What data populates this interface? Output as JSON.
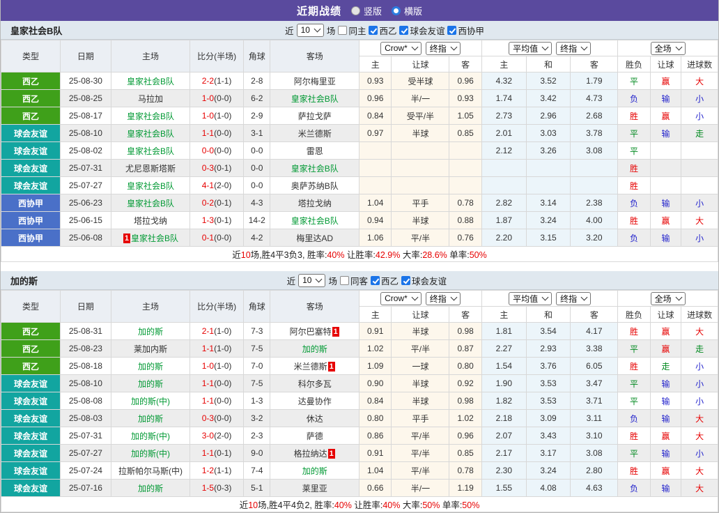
{
  "title_bar": {
    "title": "近期战绩",
    "radios": [
      {
        "label": "竖版",
        "selected": false
      },
      {
        "label": "横版",
        "selected": true
      }
    ]
  },
  "colors": {
    "topbar": "#5a4a9e",
    "league_green": "#3fa01a",
    "league_teal": "#12a5a0",
    "league_blue": "#4a70c8",
    "team_highlight": "#009933",
    "win_red": "#e60000",
    "loss_blue": "#2323cc",
    "draw_green": "#00891f",
    "crow_bg": "#fdf7ec",
    "avg_bg": "#ecf5fa"
  },
  "col_headers": {
    "type": "类型",
    "date": "日期",
    "home": "主场",
    "score": "比分(半场)",
    "corner": "角球",
    "away": "客场",
    "crow_select": "Crow*",
    "final_select": "终指",
    "avg_select": "平均值",
    "full_select": "全场",
    "odds_home": "主",
    "odds_handicap": "让球",
    "odds_away": "客",
    "avg_home": "主",
    "avg_draw": "和",
    "avg_away": "客",
    "result": "胜负",
    "handicap_result": "让球",
    "goals": "进球数"
  },
  "sections": [
    {
      "team": "皇家社会B队",
      "filters": {
        "recent_label": "近",
        "recent_value": "10",
        "matches_label": "场",
        "checkboxes": [
          {
            "label": "同主",
            "checked": false
          },
          {
            "label": "西乙",
            "checked": true
          },
          {
            "label": "球会友谊",
            "checked": true
          },
          {
            "label": "西协甲",
            "checked": true
          }
        ]
      },
      "rows": [
        {
          "league": "西乙",
          "lc": "green",
          "date": "25-08-30",
          "home": {
            "name": "皇家社会B队",
            "hl": true
          },
          "ft": "2-2",
          "ht": "(1-1)",
          "corner": "2-8",
          "away": {
            "name": "阿尔梅里亚",
            "hl": false
          },
          "odds": [
            "0.93",
            "受半球",
            "0.96"
          ],
          "avg": [
            "4.32",
            "3.52",
            "1.79"
          ],
          "res": [
            {
              "t": "平",
              "c": "green"
            },
            {
              "t": "赢",
              "c": "red"
            },
            {
              "t": "大",
              "c": "red"
            }
          ]
        },
        {
          "league": "西乙",
          "lc": "green",
          "date": "25-08-25",
          "home": {
            "name": "马拉加",
            "hl": false
          },
          "ft": "1-0",
          "ht": "(0-0)",
          "corner": "6-2",
          "away": {
            "name": "皇家社会B队",
            "hl": true
          },
          "odds": [
            "0.96",
            "半/一",
            "0.93"
          ],
          "avg": [
            "1.74",
            "3.42",
            "4.73"
          ],
          "res": [
            {
              "t": "负",
              "c": "blue"
            },
            {
              "t": "输",
              "c": "blue"
            },
            {
              "t": "小",
              "c": "blue"
            }
          ]
        },
        {
          "league": "西乙",
          "lc": "green",
          "date": "25-08-17",
          "home": {
            "name": "皇家社会B队",
            "hl": true
          },
          "ft": "1-0",
          "ht": "(1-0)",
          "corner": "2-9",
          "away": {
            "name": "萨拉戈萨",
            "hl": false
          },
          "odds": [
            "0.84",
            "受平/半",
            "1.05"
          ],
          "avg": [
            "2.73",
            "2.96",
            "2.68"
          ],
          "res": [
            {
              "t": "胜",
              "c": "red"
            },
            {
              "t": "赢",
              "c": "red"
            },
            {
              "t": "小",
              "c": "blue"
            }
          ]
        },
        {
          "league": "球会友谊",
          "lc": "teal",
          "date": "25-08-10",
          "home": {
            "name": "皇家社会B队",
            "hl": true
          },
          "ft": "1-1",
          "ht": "(0-0)",
          "corner": "3-1",
          "away": {
            "name": "米兰德斯",
            "hl": false
          },
          "odds": [
            "0.97",
            "半球",
            "0.85"
          ],
          "avg": [
            "2.01",
            "3.03",
            "3.78"
          ],
          "res": [
            {
              "t": "平",
              "c": "green"
            },
            {
              "t": "输",
              "c": "blue"
            },
            {
              "t": "走",
              "c": "green"
            }
          ]
        },
        {
          "league": "球会友谊",
          "lc": "teal",
          "date": "25-08-02",
          "home": {
            "name": "皇家社会B队",
            "hl": true
          },
          "ft": "0-0",
          "ht": "(0-0)",
          "corner": "0-0",
          "away": {
            "name": "雷恩",
            "hl": false
          },
          "odds": [
            "",
            "",
            ""
          ],
          "avg": [
            "2.12",
            "3.26",
            "3.08"
          ],
          "res": [
            {
              "t": "平",
              "c": "green"
            },
            {
              "t": "",
              "c": ""
            },
            {
              "t": "",
              "c": ""
            }
          ]
        },
        {
          "league": "球会友谊",
          "lc": "teal",
          "date": "25-07-31",
          "home": {
            "name": "尤尼恩斯塔斯",
            "hl": false
          },
          "ft": "0-3",
          "ht": "(0-1)",
          "corner": "0-0",
          "away": {
            "name": "皇家社会B队",
            "hl": true
          },
          "odds": [
            "",
            "",
            ""
          ],
          "avg": [
            "",
            "",
            ""
          ],
          "res": [
            {
              "t": "胜",
              "c": "red"
            },
            {
              "t": "",
              "c": ""
            },
            {
              "t": "",
              "c": ""
            }
          ]
        },
        {
          "league": "球会友谊",
          "lc": "teal",
          "date": "25-07-27",
          "home": {
            "name": "皇家社会B队",
            "hl": true
          },
          "ft": "4-1",
          "ht": "(2-0)",
          "corner": "0-0",
          "away": {
            "name": "奥萨苏纳B队",
            "hl": false
          },
          "odds": [
            "",
            "",
            ""
          ],
          "avg": [
            "",
            "",
            ""
          ],
          "res": [
            {
              "t": "胜",
              "c": "red"
            },
            {
              "t": "",
              "c": ""
            },
            {
              "t": "",
              "c": ""
            }
          ]
        },
        {
          "league": "西协甲",
          "lc": "blue",
          "date": "25-06-23",
          "home": {
            "name": "皇家社会B队",
            "hl": true
          },
          "ft": "0-2",
          "ht": "(0-1)",
          "corner": "4-3",
          "away": {
            "name": "塔拉戈纳",
            "hl": false
          },
          "odds": [
            "1.04",
            "平手",
            "0.78"
          ],
          "avg": [
            "2.82",
            "3.14",
            "2.38"
          ],
          "res": [
            {
              "t": "负",
              "c": "blue"
            },
            {
              "t": "输",
              "c": "blue"
            },
            {
              "t": "小",
              "c": "blue"
            }
          ]
        },
        {
          "league": "西协甲",
          "lc": "blue",
          "date": "25-06-15",
          "home": {
            "name": "塔拉戈纳",
            "hl": false
          },
          "ft": "1-3",
          "ht": "(0-1)",
          "corner": "14-2",
          "away": {
            "name": "皇家社会B队",
            "hl": true
          },
          "odds": [
            "0.94",
            "半球",
            "0.88"
          ],
          "avg": [
            "1.87",
            "3.24",
            "4.00"
          ],
          "res": [
            {
              "t": "胜",
              "c": "red"
            },
            {
              "t": "赢",
              "c": "red"
            },
            {
              "t": "大",
              "c": "red"
            }
          ]
        },
        {
          "league": "西协甲",
          "lc": "blue",
          "date": "25-06-08",
          "home": {
            "name": "皇家社会B队",
            "hl": true,
            "badge": "1",
            "badge_pos": "before"
          },
          "ft": "0-1",
          "ht": "(0-0)",
          "corner": "4-2",
          "away": {
            "name": "梅里达AD",
            "hl": false
          },
          "odds": [
            "1.06",
            "平/半",
            "0.76"
          ],
          "avg": [
            "2.20",
            "3.15",
            "3.20"
          ],
          "res": [
            {
              "t": "负",
              "c": "blue"
            },
            {
              "t": "输",
              "c": "blue"
            },
            {
              "t": "小",
              "c": "blue"
            }
          ]
        }
      ],
      "summary": [
        {
          "text": "近",
          "red": false
        },
        {
          "text": "10",
          "red": true
        },
        {
          "text": "场,胜4平3负3, 胜率:",
          "red": false
        },
        {
          "text": "40%",
          "red": true
        },
        {
          "text": " 让胜率:",
          "red": false
        },
        {
          "text": "42.9%",
          "red": true
        },
        {
          "text": " 大率:",
          "red": false
        },
        {
          "text": "28.6%",
          "red": true
        },
        {
          "text": " 单率:",
          "red": false
        },
        {
          "text": "50%",
          "red": true
        }
      ]
    },
    {
      "team": "加的斯",
      "filters": {
        "recent_label": "近",
        "recent_value": "10",
        "matches_label": "场",
        "checkboxes": [
          {
            "label": "同客",
            "checked": false
          },
          {
            "label": "西乙",
            "checked": true
          },
          {
            "label": "球会友谊",
            "checked": true
          }
        ]
      },
      "rows": [
        {
          "league": "西乙",
          "lc": "green",
          "date": "25-08-31",
          "home": {
            "name": "加的斯",
            "hl": true
          },
          "ft": "2-1",
          "ht": "(1-0)",
          "corner": "7-3",
          "away": {
            "name": "阿尔巴塞特",
            "hl": false,
            "badge": "1",
            "badge_pos": "after"
          },
          "odds": [
            "0.91",
            "半球",
            "0.98"
          ],
          "avg": [
            "1.81",
            "3.54",
            "4.17"
          ],
          "res": [
            {
              "t": "胜",
              "c": "red"
            },
            {
              "t": "赢",
              "c": "red"
            },
            {
              "t": "大",
              "c": "red"
            }
          ]
        },
        {
          "league": "西乙",
          "lc": "green",
          "date": "25-08-23",
          "home": {
            "name": "莱加内斯",
            "hl": false
          },
          "ft": "1-1",
          "ht": "(1-0)",
          "corner": "7-5",
          "away": {
            "name": "加的斯",
            "hl": true
          },
          "odds": [
            "1.02",
            "平/半",
            "0.87"
          ],
          "avg": [
            "2.27",
            "2.93",
            "3.38"
          ],
          "res": [
            {
              "t": "平",
              "c": "green"
            },
            {
              "t": "赢",
              "c": "red"
            },
            {
              "t": "走",
              "c": "green"
            }
          ]
        },
        {
          "league": "西乙",
          "lc": "green",
          "date": "25-08-18",
          "home": {
            "name": "加的斯",
            "hl": true
          },
          "ft": "1-0",
          "ht": "(1-0)",
          "corner": "7-0",
          "away": {
            "name": "米兰德斯",
            "hl": false,
            "badge": "1",
            "badge_pos": "after"
          },
          "odds": [
            "1.09",
            "一球",
            "0.80"
          ],
          "avg": [
            "1.54",
            "3.76",
            "6.05"
          ],
          "res": [
            {
              "t": "胜",
              "c": "red"
            },
            {
              "t": "走",
              "c": "green"
            },
            {
              "t": "小",
              "c": "blue"
            }
          ]
        },
        {
          "league": "球会友谊",
          "lc": "teal",
          "date": "25-08-10",
          "home": {
            "name": "加的斯",
            "hl": true
          },
          "ft": "1-1",
          "ht": "(0-0)",
          "corner": "7-5",
          "away": {
            "name": "科尔多瓦",
            "hl": false
          },
          "odds": [
            "0.90",
            "半球",
            "0.92"
          ],
          "avg": [
            "1.90",
            "3.53",
            "3.47"
          ],
          "res": [
            {
              "t": "平",
              "c": "green"
            },
            {
              "t": "输",
              "c": "blue"
            },
            {
              "t": "小",
              "c": "blue"
            }
          ]
        },
        {
          "league": "球会友谊",
          "lc": "teal",
          "date": "25-08-08",
          "home": {
            "name": "加的斯(中)",
            "hl": true
          },
          "ft": "1-1",
          "ht": "(0-0)",
          "corner": "1-3",
          "away": {
            "name": "达曼协作",
            "hl": false
          },
          "odds": [
            "0.84",
            "半球",
            "0.98"
          ],
          "avg": [
            "1.82",
            "3.53",
            "3.71"
          ],
          "res": [
            {
              "t": "平",
              "c": "green"
            },
            {
              "t": "输",
              "c": "blue"
            },
            {
              "t": "小",
              "c": "blue"
            }
          ]
        },
        {
          "league": "球会友谊",
          "lc": "teal",
          "date": "25-08-03",
          "home": {
            "name": "加的斯",
            "hl": true
          },
          "ft": "0-3",
          "ht": "(0-0)",
          "corner": "3-2",
          "away": {
            "name": "休达",
            "hl": false
          },
          "odds": [
            "0.80",
            "平手",
            "1.02"
          ],
          "avg": [
            "2.18",
            "3.09",
            "3.11"
          ],
          "res": [
            {
              "t": "负",
              "c": "blue"
            },
            {
              "t": "输",
              "c": "blue"
            },
            {
              "t": "大",
              "c": "red"
            }
          ]
        },
        {
          "league": "球会友谊",
          "lc": "teal",
          "date": "25-07-31",
          "home": {
            "name": "加的斯(中)",
            "hl": true
          },
          "ft": "3-0",
          "ht": "(2-0)",
          "corner": "2-3",
          "away": {
            "name": "萨德",
            "hl": false
          },
          "odds": [
            "0.86",
            "平/半",
            "0.96"
          ],
          "avg": [
            "2.07",
            "3.43",
            "3.10"
          ],
          "res": [
            {
              "t": "胜",
              "c": "red"
            },
            {
              "t": "赢",
              "c": "red"
            },
            {
              "t": "大",
              "c": "red"
            }
          ]
        },
        {
          "league": "球会友谊",
          "lc": "teal",
          "date": "25-07-27",
          "home": {
            "name": "加的斯(中)",
            "hl": true
          },
          "ft": "1-1",
          "ht": "(0-1)",
          "corner": "9-0",
          "away": {
            "name": "格拉纳达",
            "hl": false,
            "badge": "1",
            "badge_pos": "after"
          },
          "odds": [
            "0.91",
            "平/半",
            "0.85"
          ],
          "avg": [
            "2.17",
            "3.17",
            "3.08"
          ],
          "res": [
            {
              "t": "平",
              "c": "green"
            },
            {
              "t": "输",
              "c": "blue"
            },
            {
              "t": "小",
              "c": "blue"
            }
          ]
        },
        {
          "league": "球会友谊",
          "lc": "teal",
          "date": "25-07-24",
          "home": {
            "name": "拉斯帕尔马斯(中)",
            "hl": false
          },
          "ft": "1-2",
          "ht": "(1-1)",
          "corner": "7-4",
          "away": {
            "name": "加的斯",
            "hl": true
          },
          "odds": [
            "1.04",
            "平/半",
            "0.78"
          ],
          "avg": [
            "2.30",
            "3.24",
            "2.80"
          ],
          "res": [
            {
              "t": "胜",
              "c": "red"
            },
            {
              "t": "赢",
              "c": "red"
            },
            {
              "t": "大",
              "c": "red"
            }
          ]
        },
        {
          "league": "球会友谊",
          "lc": "teal",
          "date": "25-07-16",
          "home": {
            "name": "加的斯",
            "hl": true
          },
          "ft": "1-5",
          "ht": "(0-3)",
          "corner": "5-1",
          "away": {
            "name": "莱里亚",
            "hl": false
          },
          "odds": [
            "0.66",
            "半/一",
            "1.19"
          ],
          "avg": [
            "1.55",
            "4.08",
            "4.63"
          ],
          "res": [
            {
              "t": "负",
              "c": "blue"
            },
            {
              "t": "输",
              "c": "blue"
            },
            {
              "t": "大",
              "c": "red"
            }
          ]
        }
      ],
      "summary": [
        {
          "text": "近",
          "red": false
        },
        {
          "text": "10",
          "red": true
        },
        {
          "text": "场,胜4平4负2, 胜率:",
          "red": false
        },
        {
          "text": "40%",
          "red": true
        },
        {
          "text": " 让胜率:",
          "red": false
        },
        {
          "text": "40%",
          "red": true
        },
        {
          "text": " 大率:",
          "red": false
        },
        {
          "text": "50%",
          "red": true
        },
        {
          "text": " 单率:",
          "red": false
        },
        {
          "text": "50%",
          "red": true
        }
      ]
    }
  ]
}
